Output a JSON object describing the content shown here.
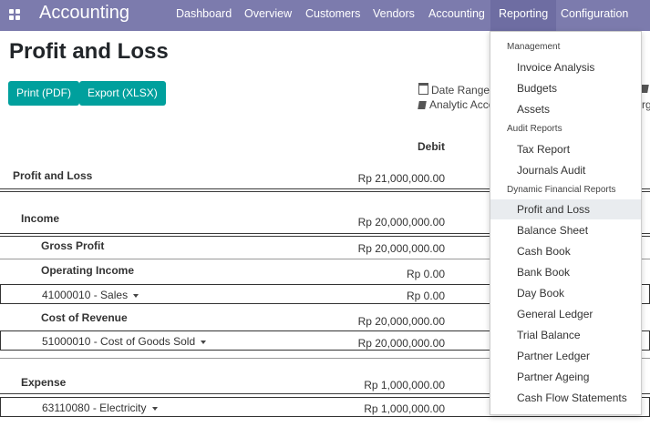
{
  "topbar": {
    "brand": "Accounting",
    "menu": [
      "Dashboard",
      "Overview",
      "Customers",
      "Vendors",
      "Accounting",
      "Reporting",
      "Configuration"
    ],
    "active_menu": "Reporting"
  },
  "page": {
    "title": "Profit and Loss",
    "print_pdf": "Print (PDF)",
    "export_xlsx": "Export (XLSX)",
    "filter_date_range": "Date Range",
    "filter_analytic": "Analytic Acco",
    "filter_right_partial": "rg",
    "col_debit": "Debit"
  },
  "report_rows": [
    {
      "label": "Profit and Loss",
      "debit": "Rp 21,000,000.00"
    },
    {
      "label": "Income",
      "debit": "Rp 20,000,000.00"
    },
    {
      "label": "Gross Profit",
      "debit": "Rp 20,000,000.00"
    },
    {
      "label": "Operating Income",
      "debit": "Rp 0.00"
    },
    {
      "label": "41000010 - Sales",
      "debit": "Rp 0.00"
    },
    {
      "label": "Cost of Revenue",
      "debit": "Rp 20,000,000.00"
    },
    {
      "label": "51000010 - Cost of Goods Sold",
      "debit": "Rp 20,000,000.00"
    },
    {
      "label": "Expense",
      "debit": "Rp 1,000,000.00"
    },
    {
      "label": "63110080 - Electricity",
      "debit": "Rp 1,000,000.00"
    }
  ],
  "dropdown": {
    "section_management": "Management",
    "management_items": [
      "Invoice Analysis",
      "Budgets",
      "Assets"
    ],
    "section_audit": "Audit Reports",
    "audit_items": [
      "Tax Report",
      "Journals Audit"
    ],
    "section_dynamic": "Dynamic Financial Reports",
    "dynamic_items": [
      "Profit and Loss",
      "Balance Sheet",
      "Cash Book",
      "Bank Book",
      "Day Book",
      "General Ledger",
      "Trial Balance",
      "Partner Ledger",
      "Partner Ageing",
      "Cash Flow Statements"
    ]
  }
}
